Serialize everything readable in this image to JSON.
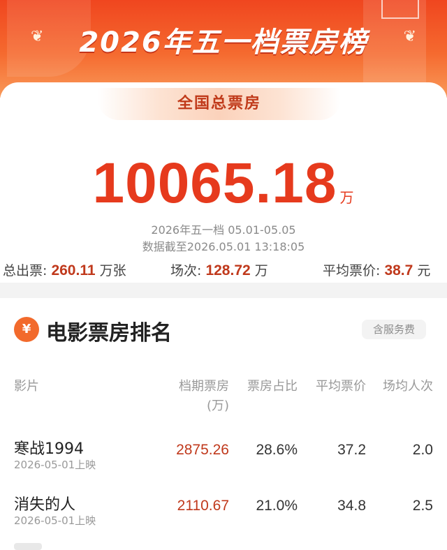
{
  "banner": {
    "title": "2026年五一档票房榜",
    "laurel_left": "❦",
    "laurel_right": "❦"
  },
  "summary": {
    "label": "全国总票房",
    "total": "10065.18",
    "total_unit": "万",
    "period": "2026年五一档 05.01-05.05",
    "cutoff": "数据截至2026.05.01 13:18:05",
    "stats": {
      "tickets_label": "总出票:",
      "tickets_value": "260.11",
      "tickets_unit": "万张",
      "shows_label": "场次:",
      "shows_value": "128.72",
      "shows_unit": "万",
      "avg_price_label": "平均票价:",
      "avg_price_value": "38.7",
      "avg_price_unit": "元"
    }
  },
  "ranking": {
    "icon": "ticket-icon",
    "icon_glyph": "¥",
    "title": "电影票房排名",
    "service_tag": "含服务费",
    "columns": {
      "film": "影片",
      "box_office": "档期票房",
      "box_office_unit": "(万)",
      "share": "票房占比",
      "avg_price": "平均票价",
      "avg_attendance": "场均人次"
    },
    "rows": [
      {
        "title": "寒战1994",
        "date": "2026-05-01上映",
        "box_office": "2875.26",
        "share": "28.6%",
        "avg_price": "37.2",
        "avg_attendance": "2.0"
      },
      {
        "title": "消失的人",
        "date": "2026-05-01上映",
        "box_office": "2110.67",
        "share": "21.0%",
        "avg_price": "34.8",
        "avg_attendance": "2.5"
      }
    ]
  },
  "colors": {
    "accent": "#e63a1d",
    "banner": "#f0461f",
    "box_value": "#c0391c"
  }
}
